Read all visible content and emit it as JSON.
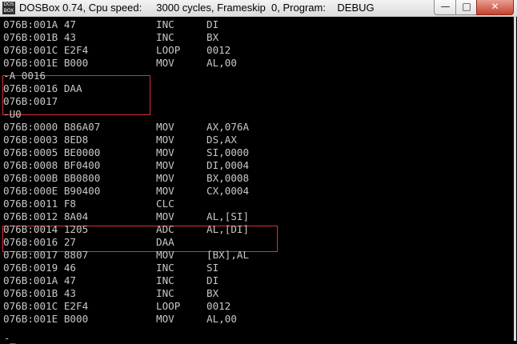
{
  "window": {
    "icon_text": "DOS BOX",
    "title": "DOSBox 0.74, Cpu speed:     3000 cycles, Frameskip  0, Program:    DEBUG",
    "minimize_glyph": "—",
    "maximize_glyph": "□",
    "close_glyph": "✕"
  },
  "colors": {
    "screen_bg": "#000000",
    "text": "#c8c8c8",
    "highlight_border": "#e03030"
  },
  "lines": [
    [
      "076B:001A 47",
      "INC",
      "DI"
    ],
    [
      "076B:001B 43",
      "INC",
      "BX"
    ],
    [
      "076B:001C E2F4",
      "LOOP",
      "0012"
    ],
    [
      "076B:001E B000",
      "MOV",
      "AL,00"
    ],
    [
      "-A 0016",
      "",
      ""
    ],
    [
      "076B:0016 DAA",
      "",
      ""
    ],
    [
      "076B:0017",
      "",
      ""
    ],
    [
      "-U0",
      "",
      ""
    ],
    [
      "076B:0000 B86A07",
      "MOV",
      "AX,076A"
    ],
    [
      "076B:0003 8ED8",
      "MOV",
      "DS,AX"
    ],
    [
      "076B:0005 BE0000",
      "MOV",
      "SI,0000"
    ],
    [
      "076B:0008 BF0400",
      "MOV",
      "DI,0004"
    ],
    [
      "076B:000B BB0800",
      "MOV",
      "BX,0008"
    ],
    [
      "076B:000E B90400",
      "MOV",
      "CX,0004"
    ],
    [
      "076B:0011 F8",
      "CLC",
      ""
    ],
    [
      "076B:0012 8A04",
      "MOV",
      "AL,[SI]"
    ],
    [
      "076B:0014 1205",
      "ADC",
      "AL,[DI]"
    ],
    [
      "076B:0016 27",
      "DAA",
      ""
    ],
    [
      "076B:0017 8807",
      "MOV",
      "[BX],AL"
    ],
    [
      "076B:0019 46",
      "INC",
      "SI"
    ],
    [
      "076B:001A 47",
      "INC",
      "DI"
    ],
    [
      "076B:001B 43",
      "INC",
      "BX"
    ],
    [
      "076B:001C E2F4",
      "LOOP",
      "0012"
    ],
    [
      "076B:001E B000",
      "MOV",
      "AL,00"
    ]
  ],
  "prompt": "-_"
}
